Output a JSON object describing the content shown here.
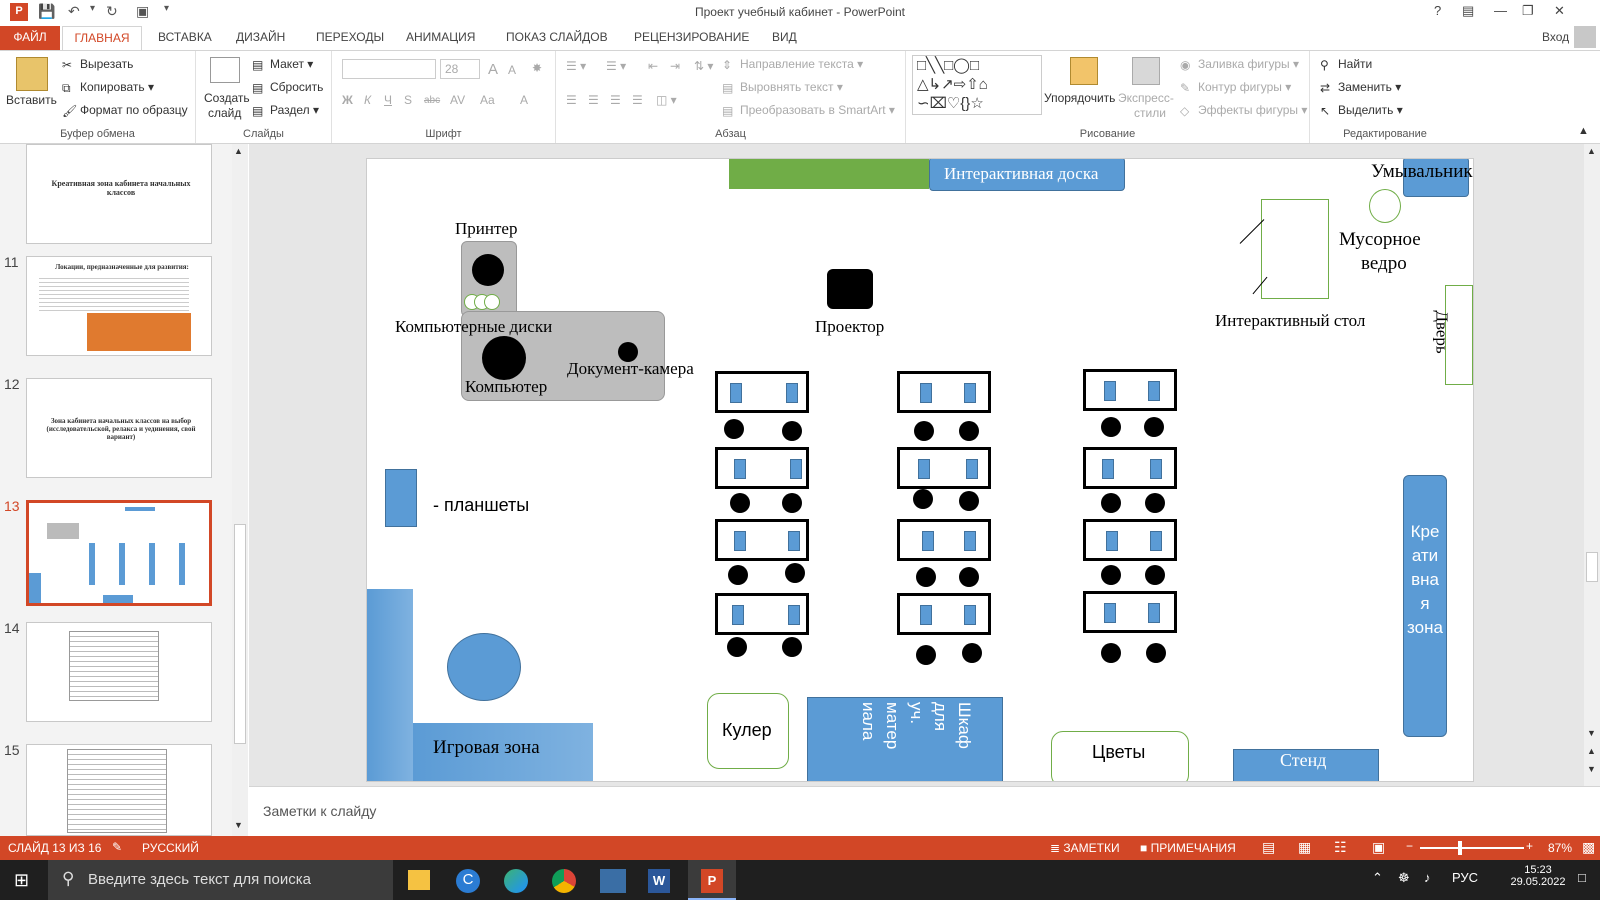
{
  "window": {
    "title": "Проект учебный кабинет - PowerPoint",
    "help": "?",
    "account": "Вход"
  },
  "tabs": {
    "file": "ФАЙЛ",
    "home": "ГЛАВНАЯ",
    "insert": "ВСТАВКА",
    "design": "ДИЗАЙН",
    "transitions": "ПЕРЕХОДЫ",
    "animation": "АНИМАЦИЯ",
    "slideshow": "ПОКАЗ СЛАЙДОВ",
    "review": "РЕЦЕНЗИРОВАНИЕ",
    "view": "ВИД"
  },
  "ribbon": {
    "clipboard": {
      "paste": "Вставить",
      "cut": "Вырезать",
      "copy": "Копировать",
      "format_painter": "Формат по образцу",
      "label": "Буфер обмена"
    },
    "slides": {
      "new_slide_1": "Создать",
      "new_slide_2": "слайд",
      "layout": "Макет",
      "reset": "Сбросить",
      "section": "Раздел",
      "label": "Слайды"
    },
    "font": {
      "size": "28",
      "bold": "Ж",
      "italic": "К",
      "underline": "Ч",
      "shadow": "S",
      "strike": "abc",
      "spacing": "AV",
      "case": "Aa",
      "color": "A",
      "grow": "A",
      "shrink": "A",
      "label": "Шрифт"
    },
    "paragraph": {
      "text_direction": "Направление текста",
      "align_text": "Выровнять текст",
      "smartart": "Преобразовать в SmartArt",
      "label": "Абзац"
    },
    "drawing": {
      "arrange": "Упорядочить",
      "quick_styles_1": "Экспресс-",
      "quick_styles_2": "стили",
      "fill": "Заливка фигуры",
      "outline": "Контур фигуры",
      "effects": "Эффекты фигуры",
      "label": "Рисование"
    },
    "editing": {
      "find": "Найти",
      "replace": "Заменить",
      "select": "Выделить",
      "label": "Редактирование"
    }
  },
  "thumbnails": [
    {
      "num": "",
      "title": "Креативная зона кабинета начальных классов"
    },
    {
      "num": "11",
      "title": "Локации, предназначенные для развития:"
    },
    {
      "num": "12",
      "title": "Зона кабинета начальных классов на выбор (исследовательской, релакса и уединения, свой вариант)"
    },
    {
      "num": "13",
      "title": ""
    },
    {
      "num": "14",
      "title": ""
    },
    {
      "num": "15",
      "title": ""
    }
  ],
  "slide": {
    "interactive_board": "Интерактивная доска",
    "sink": "Умывальник",
    "printer": "Принтер",
    "trash_1": "Мусорное",
    "trash_2": "ведро",
    "projector": "Проектор",
    "interactive_table": "Интерактивный стол",
    "door": "Дверь",
    "disks": "Компьютерные диски",
    "doc_camera": "Документ-камера",
    "computer": "Компьютер",
    "tablets": "- планшеты",
    "creative_zone": "Креативная зона",
    "creative_zone_lines": [
      "Кре",
      "ати",
      "вна",
      "я",
      "зона"
    ],
    "play_zone": "Игровая зона",
    "cooler": "Кулер",
    "cabinet_lines": [
      "Шкаф",
      "для",
      "уч.",
      "матер",
      "иала"
    ],
    "flowers": "Цветы",
    "stand": "Стенд"
  },
  "notes": {
    "placeholder": "Заметки к слайду"
  },
  "status": {
    "slide": "СЛАЙД 13 ИЗ 16",
    "lang": "РУССКИЙ",
    "notes": "ЗАМЕТКИ",
    "comments": "ПРИМЕЧАНИЯ",
    "zoom": "87%"
  },
  "taskbar": {
    "search": "Введите здесь текст для поиска",
    "lang": "РУС",
    "time": "15:23",
    "date": "29.05.2022"
  },
  "colors": {
    "accent": "#d24726",
    "shape_blue": "#5b9bd5",
    "board_green": "#70ad47"
  }
}
